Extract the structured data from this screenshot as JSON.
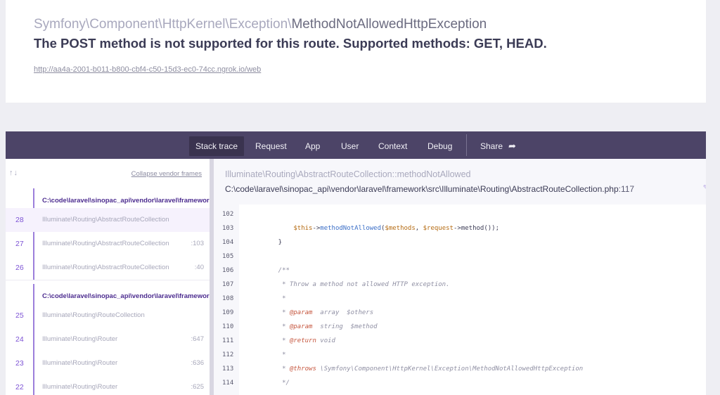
{
  "header": {
    "exception_namespace": "Symfony\\Component\\HttpKernel\\Exception\\",
    "exception_class": "MethodNotAllowedHttpException",
    "message": "The POST method is not supported for this route. Supported methods: GET, HEAD.",
    "url": "http://aa4a-2001-b011-b800-cbf4-c50-15d3-ec0-74cc.ngrok.io/web"
  },
  "nav": {
    "tabs": [
      "Stack trace",
      "Request",
      "App",
      "User",
      "Context",
      "Debug"
    ],
    "active_tab": "Stack trace",
    "share_label": "Share"
  },
  "frames_toolbar": {
    "sort_arrows": "↑↓",
    "collapse_label": "Collapse vendor frames"
  },
  "frame_groups": [
    {
      "vendor_path": "C:\\code\\laravel\\sinopac_api\\vendor\\laravel\\framework",
      "frames": [
        {
          "num": "28",
          "cls": "Illuminate\\Routing\\AbstractRouteCollection",
          "line": "",
          "selected": true
        },
        {
          "num": "27",
          "cls": "Illuminate\\Routing\\AbstractRouteCollection",
          "line": ":103",
          "selected": false
        },
        {
          "num": "26",
          "cls": "Illuminate\\Routing\\AbstractRouteCollection",
          "line": ":40",
          "selected": false
        }
      ]
    },
    {
      "vendor_path": "C:\\code\\laravel\\sinopac_api\\vendor\\laravel\\framework",
      "frames": [
        {
          "num": "25",
          "cls": "Illuminate\\Routing\\RouteCollection",
          "line": "",
          "selected": false
        },
        {
          "num": "24",
          "cls": "Illuminate\\Routing\\Router",
          "line": ":647",
          "selected": false
        },
        {
          "num": "23",
          "cls": "Illuminate\\Routing\\Router",
          "line": ":636",
          "selected": false
        },
        {
          "num": "22",
          "cls": "Illuminate\\Routing\\Router",
          "line": ":625",
          "selected": false
        }
      ]
    }
  ],
  "code": {
    "class_path": "Illuminate\\Routing\\AbstractRouteCollection",
    "method": "::methodNotAllowed",
    "file": "C:\\code\\laravel\\sinopac_api\\vendor\\laravel\\framework\\src\\Illuminate\\Routing\\AbstractRouteCollection.php",
    "line_suffix": ":117",
    "lines": [
      {
        "n": "102",
        "parts": []
      },
      {
        "n": "103",
        "parts": [
          [
            "        ",
            ""
          ],
          [
            "$this",
            "c-var"
          ],
          [
            "->",
            ""
          ],
          [
            "methodNotAllowed",
            "c-fn"
          ],
          [
            "(",
            ""
          ],
          [
            "$methods",
            "c-var"
          ],
          [
            ", ",
            ""
          ],
          [
            "$request",
            "c-var"
          ],
          [
            "->method());",
            ""
          ]
        ]
      },
      {
        "n": "104",
        "parts": [
          [
            "    }",
            ""
          ]
        ]
      },
      {
        "n": "105",
        "parts": []
      },
      {
        "n": "106",
        "parts": [
          [
            "    /**",
            "c-com"
          ]
        ]
      },
      {
        "n": "107",
        "parts": [
          [
            "     * Throw a method not allowed HTTP exception.",
            "c-com"
          ]
        ]
      },
      {
        "n": "108",
        "parts": [
          [
            "     *",
            "c-com"
          ]
        ]
      },
      {
        "n": "109",
        "parts": [
          [
            "     * ",
            "c-com"
          ],
          [
            "@param",
            "c-tag"
          ],
          [
            "  array  $others",
            "c-com"
          ]
        ]
      },
      {
        "n": "110",
        "parts": [
          [
            "     * ",
            "c-com"
          ],
          [
            "@param",
            "c-tag"
          ],
          [
            "  string  $method",
            "c-com"
          ]
        ]
      },
      {
        "n": "111",
        "parts": [
          [
            "     * ",
            "c-com"
          ],
          [
            "@return",
            "c-tag"
          ],
          [
            " void",
            "c-com"
          ]
        ]
      },
      {
        "n": "112",
        "parts": [
          [
            "     *",
            "c-com"
          ]
        ]
      },
      {
        "n": "113",
        "parts": [
          [
            "     * ",
            "c-com"
          ],
          [
            "@throws",
            "c-tag"
          ],
          [
            " \\Symfony\\Component\\HttpKernel\\Exception\\MethodNotAllowedHttpException",
            "c-com"
          ]
        ]
      },
      {
        "n": "114",
        "parts": [
          [
            "     */",
            "c-com"
          ]
        ]
      }
    ]
  },
  "colors": {
    "nav_bg": "#4c4467",
    "accent": "#7d53d5",
    "vendor_head": "#4c2c8f"
  }
}
